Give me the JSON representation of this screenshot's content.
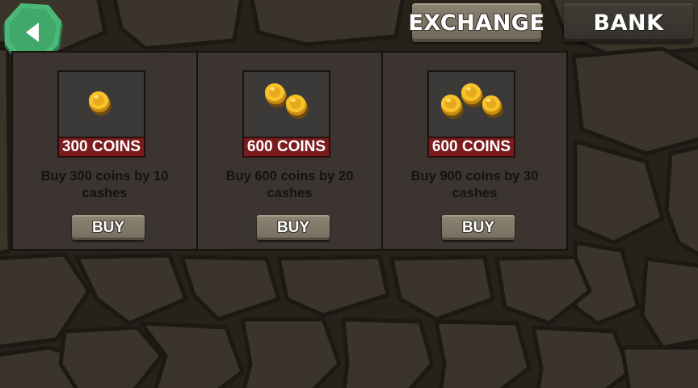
{
  "header": {
    "back_icon": "back-arrow-icon",
    "tabs": [
      {
        "label": "EXCHANGE",
        "selected": true
      },
      {
        "label": "BANK",
        "selected": false
      }
    ]
  },
  "shop": {
    "items": [
      {
        "coin_label": "300 COINS",
        "description": "Buy 300 coins by 10 cashes",
        "buy_label": "BUY",
        "coin_count": 1,
        "icon": "coin-stack-icon"
      },
      {
        "coin_label": "600 COINS",
        "description": "Buy 600 coins by 20 cashes",
        "buy_label": "BUY",
        "coin_count": 2,
        "icon": "coin-stack-icon"
      },
      {
        "coin_label": "600 COINS",
        "description": "Buy 900 coins by 30 cashes",
        "buy_label": "BUY",
        "coin_count": 3,
        "icon": "coin-stack-icon"
      }
    ]
  },
  "colors": {
    "back_button": "#3fa86a",
    "label_background": "#7a1c1e",
    "coin_gold": "#f2b51c"
  }
}
